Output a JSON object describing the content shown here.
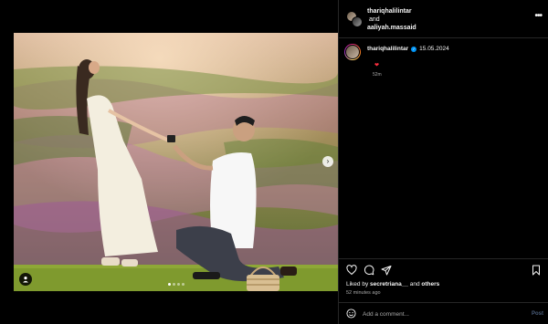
{
  "header": {
    "user1": "thariqhalilintar",
    "joiner": "and",
    "user2": "aaliyah.massaid",
    "more_glyph": "•••"
  },
  "caption": {
    "username": "thariqhalilintar",
    "text": "15.05.2024",
    "emoji": "❤",
    "time": "52m"
  },
  "likes": {
    "prefix": "Liked by ",
    "user": "secretriana__",
    "middle": " and ",
    "others": "others"
  },
  "post_time": "52 minutes ago",
  "comment": {
    "placeholder": "Add a comment...",
    "post_label": "Post"
  },
  "icons": {
    "like": "heart-icon",
    "comment": "comment-icon",
    "share": "share-icon",
    "save": "bookmark-icon",
    "next": "chevron-right-icon",
    "tag": "user-tag-icon",
    "emoji": "emoji-icon"
  },
  "carousel": {
    "slides": 4,
    "active": 0
  },
  "colors": {
    "background": "#000000",
    "verified": "#0095f6",
    "heart": "#ff3040"
  }
}
